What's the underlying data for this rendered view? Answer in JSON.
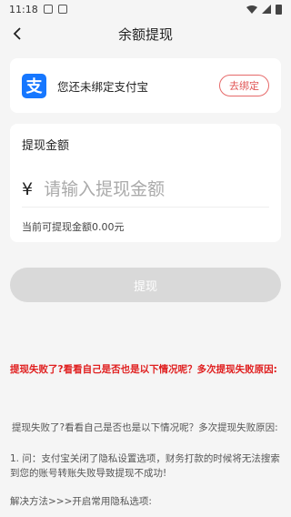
{
  "status_bar": {
    "time": "11:18"
  },
  "nav": {
    "title": "余额提现"
  },
  "alipay": {
    "logo_char": "支",
    "bind_text": "您还未绑定支付宝",
    "bind_button": "去绑定"
  },
  "amount": {
    "label": "提现金额",
    "currency": "¥",
    "placeholder": "请输入提现金额",
    "available": "当前可提现金额0.00元"
  },
  "withdraw_button": "提现",
  "help": {
    "title": "提现失败了?看看自己是否也是以下情况呢？多次提现失败原因:",
    "para1": "提现失败了?看看自己是否也是以下情况呢？多次提现失败原因:",
    "para2": "1. 问：支付宝关闭了隐私设置选项，财务打款的时候将无法搜索到您的账号转账失败导致提现不成功!",
    "para3": "解决方法>>>开启常用隐私选项:"
  },
  "colors": {
    "alipay_blue": "#1677ff",
    "accent_red": "#e02020",
    "disabled_button": "#d9d9d9"
  }
}
